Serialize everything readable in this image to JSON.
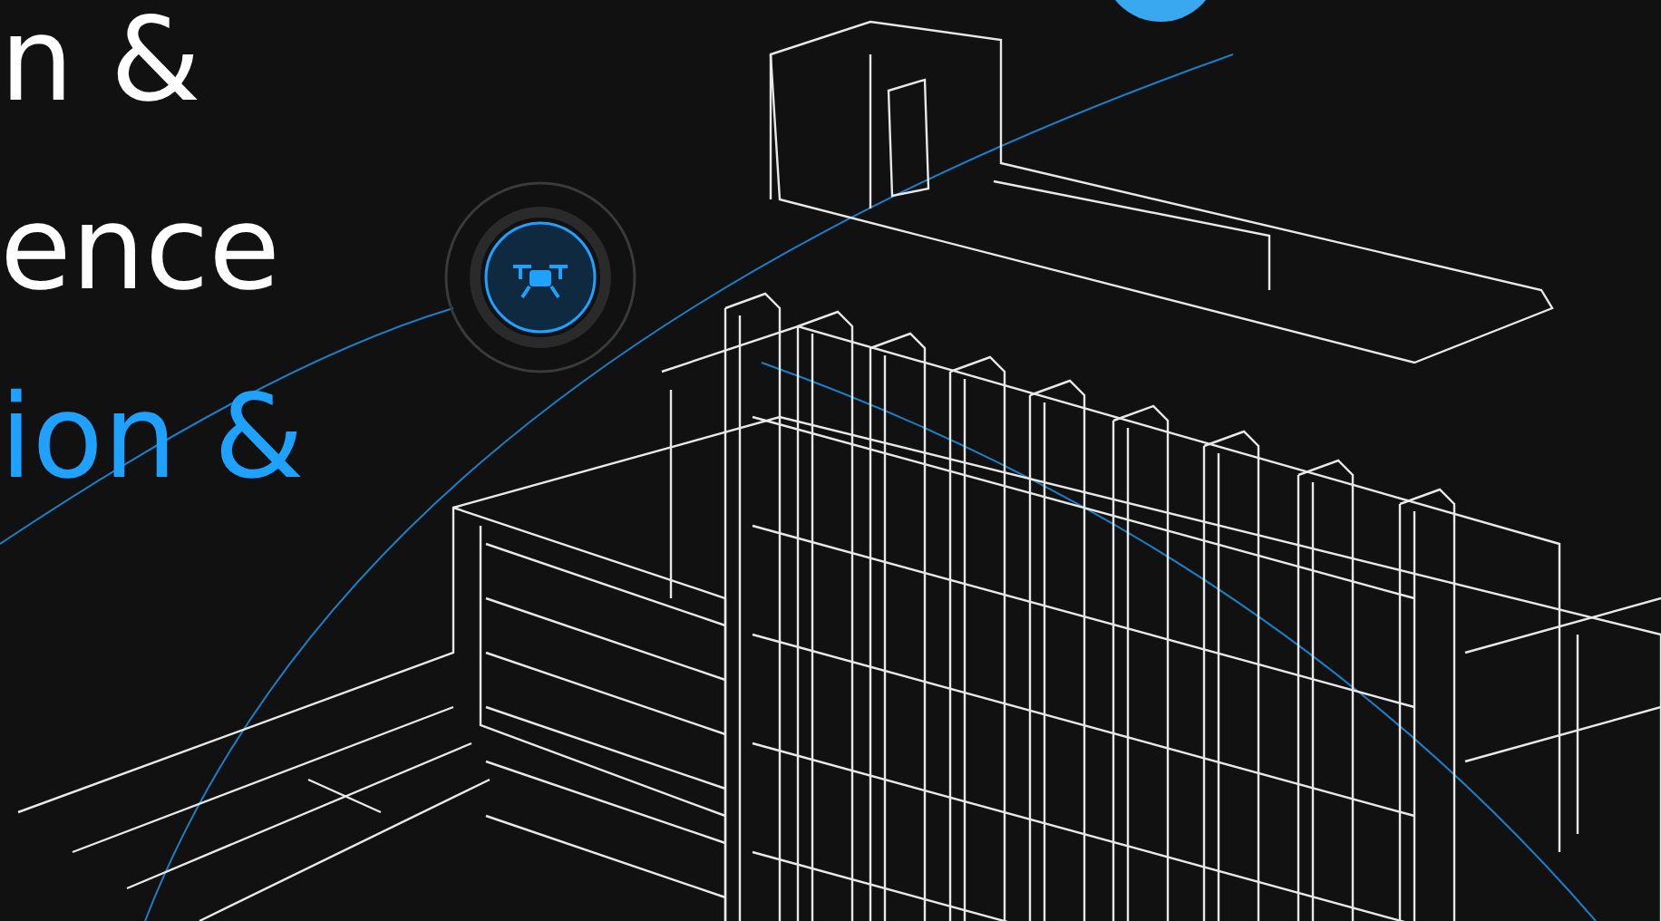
{
  "headline_lines": [
    {
      "text": "n &",
      "kind": "plain"
    },
    {
      "text": "ence",
      "kind": "plain"
    },
    {
      "text": "ion &",
      "kind": "accent"
    }
  ]
}
